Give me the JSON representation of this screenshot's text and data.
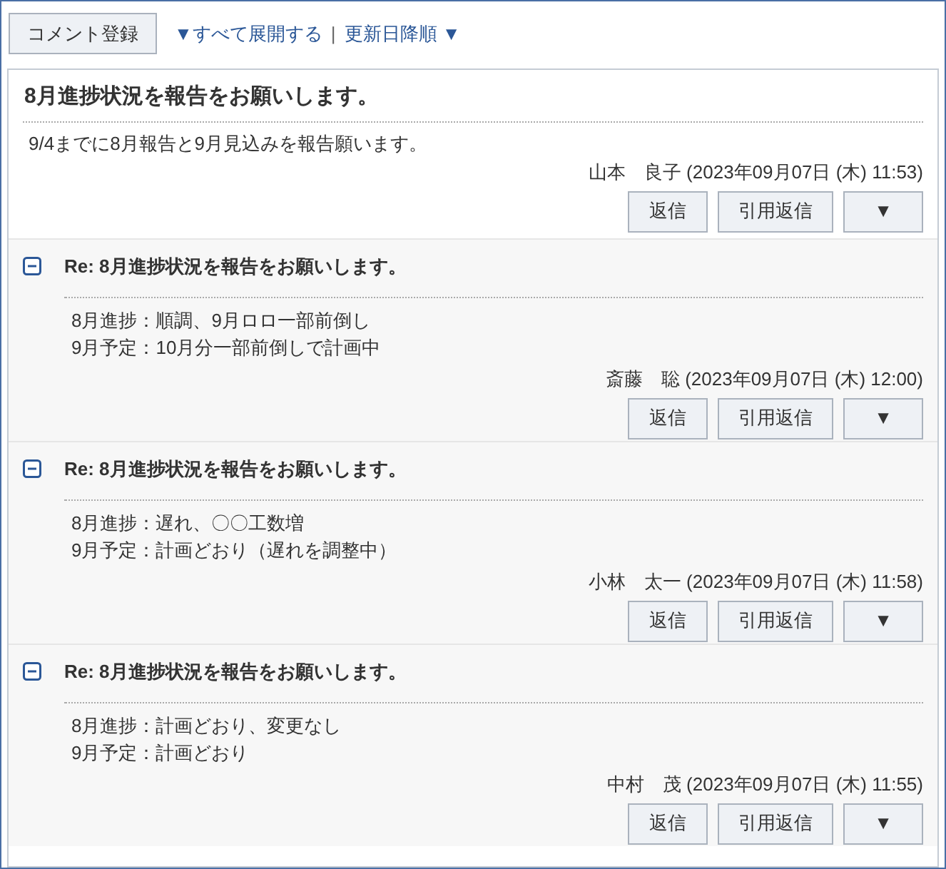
{
  "toolbar": {
    "comment_button": "コメント登録",
    "expand_all_link": "▼すべて展開する",
    "separator": "|",
    "sort_link": "更新日降順 ▼"
  },
  "topic": {
    "title": "8月進捗状況を報告をお願いします。",
    "body": [
      "9/4までに8月報告と9月見込みを報告願います。"
    ],
    "author": "山本　良子 (2023年09月07日 (木) 11:53)",
    "buttons": [
      "返信",
      "引用返信",
      "▼"
    ]
  },
  "replies": [
    {
      "expanded": true,
      "title": "Re: 8月進捗状況を報告をお願いします。",
      "body": [
        "8月進捗：順調、9月ロロ一部前倒し",
        "9月予定：10月分一部前倒しで計画中"
      ],
      "author": "斎藤　聡 (2023年09月07日 (木) 12:00)",
      "buttons": [
        "返信",
        "引用返信",
        "▼"
      ]
    },
    {
      "expanded": true,
      "title": "Re: 8月進捗状況を報告をお願いします。",
      "body": [
        "8月進捗：遅れ、〇〇工数増",
        "9月予定：計画どおり（遅れを調整中）"
      ],
      "author": "小林　太一 (2023年09月07日 (木) 11:58)",
      "buttons": [
        "返信",
        "引用返信",
        "▼"
      ]
    },
    {
      "expanded": true,
      "title": "Re: 8月進捗状況を報告をお願いします。",
      "body": [
        "8月進捗：計画どおり、変更なし",
        "9月予定：計画どおり"
      ],
      "author": "中村　茂 (2023年09月07日 (木) 11:55)",
      "buttons": [
        "返信",
        "引用返信",
        "▼"
      ]
    }
  ]
}
